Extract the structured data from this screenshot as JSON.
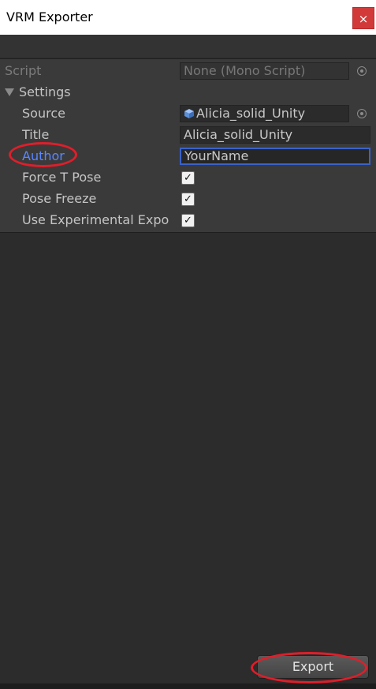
{
  "window": {
    "title": "VRM Exporter",
    "close_glyph": "×"
  },
  "inspector": {
    "script": {
      "label": "Script",
      "value": "None (Mono Script)"
    },
    "settings": {
      "label": "Settings"
    },
    "source": {
      "label": "Source",
      "value": "Alicia_solid_Unity",
      "icon": "prefab-cube-icon"
    },
    "title": {
      "label": "Title",
      "value": "Alicia_solid_Unity"
    },
    "author": {
      "label": "Author",
      "value": "YourName"
    },
    "force_t_pose": {
      "label": "Force T Pose",
      "checked": true
    },
    "pose_freeze": {
      "label": "Pose Freeze",
      "checked": true
    },
    "use_experimental": {
      "label": "Use Experimental Expo",
      "checked": true
    }
  },
  "footer": {
    "export_label": "Export"
  },
  "colors": {
    "accent_label": "#5a86ff",
    "annotation": "#e01e2a",
    "focus_border": "#3a62c9"
  }
}
